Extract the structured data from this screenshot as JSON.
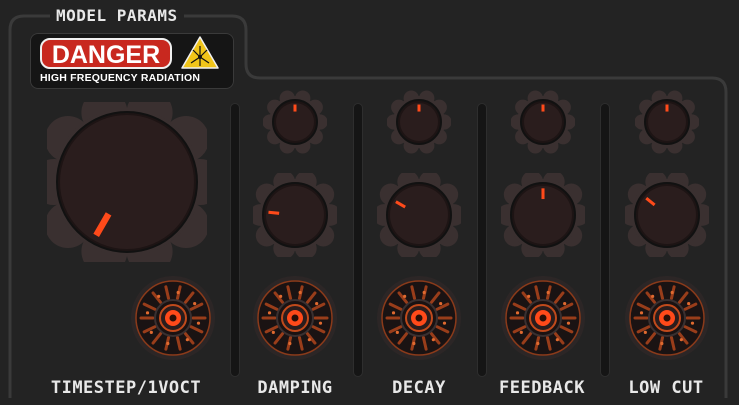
{
  "panel": {
    "title": "MODEL PARAMS",
    "colors": {
      "background": "#232323",
      "accent": "#ff4a1a",
      "knob": "#2a1d1d",
      "knob_ring": "#3a3030"
    }
  },
  "warning": {
    "label": "DANGER",
    "sublabel": "HIGH FREQUENCY RADIATION",
    "icon": "radiation-warning-icon",
    "colors": {
      "badge": "#c8281f",
      "icon": "#f0c419"
    }
  },
  "main_knob": {
    "label": "TIMESTEP/1VOCT",
    "level": 0.0
  },
  "columns": [
    {
      "id": "damping",
      "label": "DAMPING",
      "top_knob_level": 0.5,
      "mid_knob_level": 0.22
    },
    {
      "id": "decay",
      "label": "DECAY",
      "top_knob_level": 0.5,
      "mid_knob_level": 0.3
    },
    {
      "id": "feedback",
      "label": "FEEDBACK",
      "top_knob_level": 0.5,
      "mid_knob_level": 0.5
    },
    {
      "id": "low_cut",
      "label": "LOW CUT",
      "top_knob_level": 0.5,
      "mid_knob_level": 0.33
    }
  ]
}
